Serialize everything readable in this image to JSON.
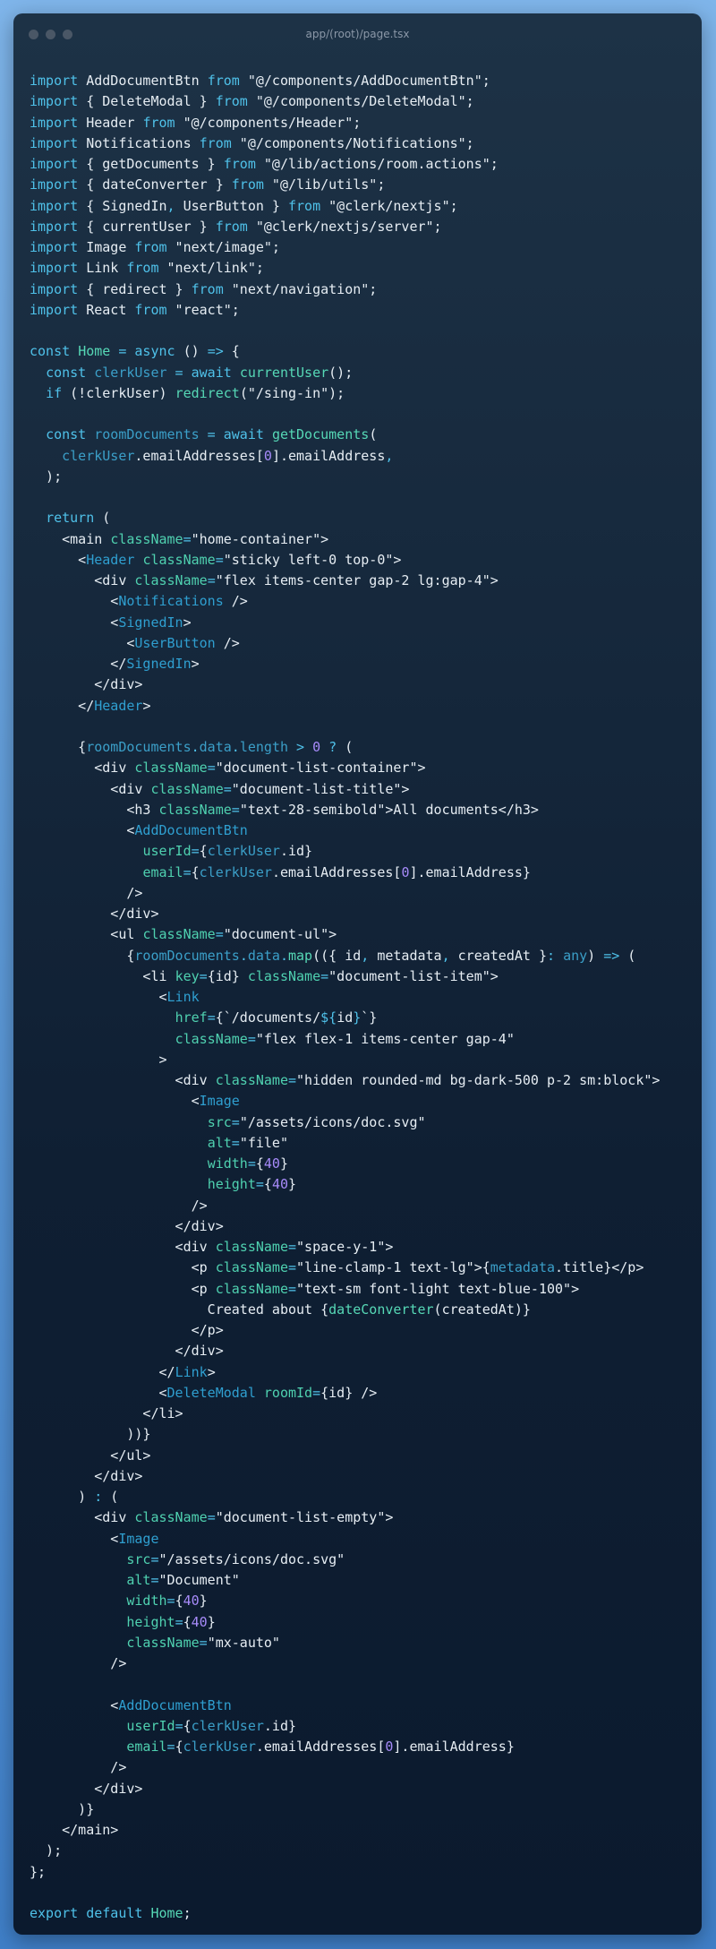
{
  "window": {
    "title": "app/(root)/page.tsx"
  },
  "colors": {
    "keyword": "#4fc1e9",
    "variable": "#3b9fc8",
    "function": "#56d8b6",
    "tag": "#2f9fd0",
    "attribute": "#4fd1b0",
    "number": "#a78bfa",
    "text": "#e6edf3"
  },
  "code_lines": [
    [
      [
        "kw",
        "import"
      ],
      [
        "p",
        " AddDocumentBtn "
      ],
      [
        "kw",
        "from"
      ],
      [
        "s",
        " \"@/components/AddDocumentBtn\";"
      ]
    ],
    [
      [
        "kw",
        "import"
      ],
      [
        "p",
        " { DeleteModal } "
      ],
      [
        "kw",
        "from"
      ],
      [
        "s",
        " \"@/components/DeleteModal\";"
      ]
    ],
    [
      [
        "kw",
        "import"
      ],
      [
        "p",
        " Header "
      ],
      [
        "kw",
        "from"
      ],
      [
        "s",
        " \"@/components/Header\";"
      ]
    ],
    [
      [
        "kw",
        "import"
      ],
      [
        "p",
        " Notifications "
      ],
      [
        "kw",
        "from"
      ],
      [
        "s",
        " \"@/components/Notifications\";"
      ]
    ],
    [
      [
        "kw",
        "import"
      ],
      [
        "p",
        " { getDocuments } "
      ],
      [
        "kw",
        "from"
      ],
      [
        "s",
        " \"@/lib/actions/room.actions\";"
      ]
    ],
    [
      [
        "kw",
        "import"
      ],
      [
        "p",
        " { dateConverter } "
      ],
      [
        "kw",
        "from"
      ],
      [
        "s",
        " \"@/lib/utils\";"
      ]
    ],
    [
      [
        "kw",
        "import"
      ],
      [
        "p",
        " { SignedIn"
      ],
      [
        "kw",
        ","
      ],
      [
        "p",
        " UserButton } "
      ],
      [
        "kw",
        "from"
      ],
      [
        "s",
        " \"@clerk/nextjs\";"
      ]
    ],
    [
      [
        "kw",
        "import"
      ],
      [
        "p",
        " { currentUser } "
      ],
      [
        "kw",
        "from"
      ],
      [
        "s",
        " \"@clerk/nextjs/server\";"
      ]
    ],
    [
      [
        "kw",
        "import"
      ],
      [
        "p",
        " Image "
      ],
      [
        "kw",
        "from"
      ],
      [
        "s",
        " \"next/image\";"
      ]
    ],
    [
      [
        "kw",
        "import"
      ],
      [
        "p",
        " Link "
      ],
      [
        "kw",
        "from"
      ],
      [
        "s",
        " \"next/link\";"
      ]
    ],
    [
      [
        "kw",
        "import"
      ],
      [
        "p",
        " { redirect } "
      ],
      [
        "kw",
        "from"
      ],
      [
        "s",
        " \"next/navigation\";"
      ]
    ],
    [
      [
        "kw",
        "import"
      ],
      [
        "p",
        " React "
      ],
      [
        "kw",
        "from"
      ],
      [
        "s",
        " \"react\";"
      ]
    ],
    [],
    [
      [
        "kw",
        "const"
      ],
      [
        "p",
        " "
      ],
      [
        "fn",
        "Home"
      ],
      [
        "kw",
        " = async"
      ],
      [
        "p",
        " () "
      ],
      [
        "kw",
        "=>"
      ],
      [
        "p",
        " {"
      ]
    ],
    [
      [
        "p",
        "  "
      ],
      [
        "kw",
        "const"
      ],
      [
        "p",
        " "
      ],
      [
        "var",
        "clerkUser"
      ],
      [
        "kw",
        " = await"
      ],
      [
        "p",
        " "
      ],
      [
        "fn",
        "currentUser"
      ],
      [
        "p",
        "();"
      ]
    ],
    [
      [
        "p",
        "  "
      ],
      [
        "kw",
        "if"
      ],
      [
        "p",
        " (!clerkUser) "
      ],
      [
        "fn",
        "redirect"
      ],
      [
        "p",
        "(\"/sing-in\");"
      ]
    ],
    [],
    [
      [
        "p",
        "  "
      ],
      [
        "kw",
        "const"
      ],
      [
        "p",
        " "
      ],
      [
        "var",
        "roomDocuments"
      ],
      [
        "kw",
        " = await"
      ],
      [
        "p",
        " "
      ],
      [
        "fn",
        "getDocuments"
      ],
      [
        "p",
        "("
      ]
    ],
    [
      [
        "p",
        "    "
      ],
      [
        "var",
        "clerkUser"
      ],
      [
        "p",
        ".emailAddresses["
      ],
      [
        "num",
        "0"
      ],
      [
        "p",
        "].emailAddress"
      ],
      [
        "kw",
        ","
      ]
    ],
    [
      [
        "p",
        "  );"
      ]
    ],
    [],
    [
      [
        "p",
        "  "
      ],
      [
        "kw",
        "return"
      ],
      [
        "p",
        " ("
      ]
    ],
    [
      [
        "p",
        "    <main "
      ],
      [
        "attr",
        "className"
      ],
      [
        "kw",
        "="
      ],
      [
        "s",
        "\"home-container\">"
      ]
    ],
    [
      [
        "p",
        "      <"
      ],
      [
        "tag",
        "Header"
      ],
      [
        "p",
        " "
      ],
      [
        "attr",
        "className"
      ],
      [
        "kw",
        "="
      ],
      [
        "s",
        "\"sticky left-0 top-0\">"
      ]
    ],
    [
      [
        "p",
        "        <div "
      ],
      [
        "attr",
        "className"
      ],
      [
        "kw",
        "="
      ],
      [
        "s",
        "\"flex items-center gap-2 lg:gap-4\">"
      ]
    ],
    [
      [
        "p",
        "          <"
      ],
      [
        "tag",
        "Notifications"
      ],
      [
        "p",
        " />"
      ]
    ],
    [
      [
        "p",
        "          <"
      ],
      [
        "tag",
        "SignedIn"
      ],
      [
        "p",
        ">"
      ]
    ],
    [
      [
        "p",
        "            <"
      ],
      [
        "tag",
        "UserButton"
      ],
      [
        "p",
        " />"
      ]
    ],
    [
      [
        "p",
        "          </"
      ],
      [
        "tag",
        "SignedIn"
      ],
      [
        "p",
        ">"
      ]
    ],
    [
      [
        "p",
        "        </div>"
      ]
    ],
    [
      [
        "p",
        "      </"
      ],
      [
        "tag",
        "Header"
      ],
      [
        "p",
        ">"
      ]
    ],
    [],
    [
      [
        "p",
        "      {"
      ],
      [
        "var",
        "roomDocuments"
      ],
      [
        "kw",
        "."
      ],
      [
        "var",
        "data"
      ],
      [
        "kw",
        "."
      ],
      [
        "var",
        "length"
      ],
      [
        "kw",
        " > "
      ],
      [
        "num",
        "0"
      ],
      [
        "kw",
        " ?"
      ],
      [
        "p",
        " ("
      ]
    ],
    [
      [
        "p",
        "        <div "
      ],
      [
        "attr",
        "className"
      ],
      [
        "kw",
        "="
      ],
      [
        "s",
        "\"document-list-container\">"
      ]
    ],
    [
      [
        "p",
        "          <div "
      ],
      [
        "attr",
        "className"
      ],
      [
        "kw",
        "="
      ],
      [
        "s",
        "\"document-list-title\">"
      ]
    ],
    [
      [
        "p",
        "            <h3 "
      ],
      [
        "attr",
        "className"
      ],
      [
        "kw",
        "="
      ],
      [
        "s",
        "\"text-28-semibold\">All documents</h3>"
      ]
    ],
    [
      [
        "p",
        "            <"
      ],
      [
        "tag",
        "AddDocumentBtn"
      ]
    ],
    [
      [
        "p",
        "              "
      ],
      [
        "attr",
        "userId"
      ],
      [
        "kw",
        "="
      ],
      [
        "p",
        "{"
      ],
      [
        "var",
        "clerkUser"
      ],
      [
        "p",
        ".id}"
      ]
    ],
    [
      [
        "p",
        "              "
      ],
      [
        "attr",
        "email"
      ],
      [
        "kw",
        "="
      ],
      [
        "p",
        "{"
      ],
      [
        "var",
        "clerkUser"
      ],
      [
        "p",
        ".emailAddresses["
      ],
      [
        "num",
        "0"
      ],
      [
        "p",
        "].emailAddress}"
      ]
    ],
    [
      [
        "p",
        "            />"
      ]
    ],
    [
      [
        "p",
        "          </div>"
      ]
    ],
    [
      [
        "p",
        "          <ul "
      ],
      [
        "attr",
        "className"
      ],
      [
        "kw",
        "="
      ],
      [
        "s",
        "\"document-ul\">"
      ]
    ],
    [
      [
        "p",
        "            {"
      ],
      [
        "var",
        "roomDocuments"
      ],
      [
        "kw",
        "."
      ],
      [
        "var",
        "data"
      ],
      [
        "kw",
        "."
      ],
      [
        "fn",
        "map"
      ],
      [
        "p",
        "(({ id"
      ],
      [
        "kw",
        ","
      ],
      [
        "p",
        " metadata"
      ],
      [
        "kw",
        ","
      ],
      [
        "p",
        " createdAt }"
      ],
      [
        "kw",
        ":"
      ],
      [
        "p",
        " "
      ],
      [
        "var",
        "any"
      ],
      [
        "p",
        ") "
      ],
      [
        "kw",
        "=>"
      ],
      [
        "p",
        " ("
      ]
    ],
    [
      [
        "p",
        "              <li "
      ],
      [
        "attr",
        "key"
      ],
      [
        "kw",
        "="
      ],
      [
        "p",
        "{id} "
      ],
      [
        "attr",
        "className"
      ],
      [
        "kw",
        "="
      ],
      [
        "s",
        "\"document-list-item\">"
      ]
    ],
    [
      [
        "p",
        "                <"
      ],
      [
        "tag",
        "Link"
      ]
    ],
    [
      [
        "p",
        "                  "
      ],
      [
        "attr",
        "href"
      ],
      [
        "kw",
        "="
      ],
      [
        "p",
        "{`/documents/"
      ],
      [
        "kw",
        "${"
      ],
      [
        "p",
        "id"
      ],
      [
        "kw",
        "}"
      ],
      [
        "p",
        "`}"
      ]
    ],
    [
      [
        "p",
        "                  "
      ],
      [
        "attr",
        "className"
      ],
      [
        "kw",
        "="
      ],
      [
        "s",
        "\"flex flex-1 items-center gap-4\""
      ]
    ],
    [
      [
        "p",
        "                >"
      ]
    ],
    [
      [
        "p",
        "                  <div "
      ],
      [
        "attr",
        "className"
      ],
      [
        "kw",
        "="
      ],
      [
        "s",
        "\"hidden rounded-md bg-dark-500 p-2 sm:block\">"
      ]
    ],
    [
      [
        "p",
        "                    <"
      ],
      [
        "tag",
        "Image"
      ]
    ],
    [
      [
        "p",
        "                      "
      ],
      [
        "attr",
        "src"
      ],
      [
        "kw",
        "="
      ],
      [
        "s",
        "\"/assets/icons/doc.svg\""
      ]
    ],
    [
      [
        "p",
        "                      "
      ],
      [
        "attr",
        "alt"
      ],
      [
        "kw",
        "="
      ],
      [
        "s",
        "\"file\""
      ]
    ],
    [
      [
        "p",
        "                      "
      ],
      [
        "attr",
        "width"
      ],
      [
        "kw",
        "="
      ],
      [
        "p",
        "{"
      ],
      [
        "num",
        "40"
      ],
      [
        "p",
        "}"
      ]
    ],
    [
      [
        "p",
        "                      "
      ],
      [
        "attr",
        "height"
      ],
      [
        "kw",
        "="
      ],
      [
        "p",
        "{"
      ],
      [
        "num",
        "40"
      ],
      [
        "p",
        "}"
      ]
    ],
    [
      [
        "p",
        "                    />"
      ]
    ],
    [
      [
        "p",
        "                  </div>"
      ]
    ],
    [
      [
        "p",
        "                  <div "
      ],
      [
        "attr",
        "className"
      ],
      [
        "kw",
        "="
      ],
      [
        "s",
        "\"space-y-1\">"
      ]
    ],
    [
      [
        "p",
        "                    <p "
      ],
      [
        "attr",
        "className"
      ],
      [
        "kw",
        "="
      ],
      [
        "s",
        "\"line-clamp-1 text-lg\">{"
      ],
      [
        "var",
        "metadata"
      ],
      [
        "p",
        ".title}</p>"
      ]
    ],
    [
      [
        "p",
        "                    <p "
      ],
      [
        "attr",
        "className"
      ],
      [
        "kw",
        "="
      ],
      [
        "s",
        "\"text-sm font-light text-blue-100\">"
      ]
    ],
    [
      [
        "p",
        "                      Created about {"
      ],
      [
        "fn",
        "dateConverter"
      ],
      [
        "p",
        "(createdAt)}"
      ]
    ],
    [
      [
        "p",
        "                    </p>"
      ]
    ],
    [
      [
        "p",
        "                  </div>"
      ]
    ],
    [
      [
        "p",
        "                </"
      ],
      [
        "tag",
        "Link"
      ],
      [
        "p",
        ">"
      ]
    ],
    [
      [
        "p",
        "                <"
      ],
      [
        "tag",
        "DeleteModal"
      ],
      [
        "p",
        " "
      ],
      [
        "attr",
        "roomId"
      ],
      [
        "kw",
        "="
      ],
      [
        "p",
        "{id} />"
      ]
    ],
    [
      [
        "p",
        "              </li>"
      ]
    ],
    [
      [
        "p",
        "            ))}"
      ]
    ],
    [
      [
        "p",
        "          </ul>"
      ]
    ],
    [
      [
        "p",
        "        </div>"
      ]
    ],
    [
      [
        "p",
        "      ) "
      ],
      [
        "kw",
        ":"
      ],
      [
        "p",
        " ("
      ]
    ],
    [
      [
        "p",
        "        <div "
      ],
      [
        "attr",
        "className"
      ],
      [
        "kw",
        "="
      ],
      [
        "s",
        "\"document-list-empty\">"
      ]
    ],
    [
      [
        "p",
        "          <"
      ],
      [
        "tag",
        "Image"
      ]
    ],
    [
      [
        "p",
        "            "
      ],
      [
        "attr",
        "src"
      ],
      [
        "kw",
        "="
      ],
      [
        "s",
        "\"/assets/icons/doc.svg\""
      ]
    ],
    [
      [
        "p",
        "            "
      ],
      [
        "attr",
        "alt"
      ],
      [
        "kw",
        "="
      ],
      [
        "s",
        "\"Document\""
      ]
    ],
    [
      [
        "p",
        "            "
      ],
      [
        "attr",
        "width"
      ],
      [
        "kw",
        "="
      ],
      [
        "p",
        "{"
      ],
      [
        "num",
        "40"
      ],
      [
        "p",
        "}"
      ]
    ],
    [
      [
        "p",
        "            "
      ],
      [
        "attr",
        "height"
      ],
      [
        "kw",
        "="
      ],
      [
        "p",
        "{"
      ],
      [
        "num",
        "40"
      ],
      [
        "p",
        "}"
      ]
    ],
    [
      [
        "p",
        "            "
      ],
      [
        "attr",
        "className"
      ],
      [
        "kw",
        "="
      ],
      [
        "s",
        "\"mx-auto\""
      ]
    ],
    [
      [
        "p",
        "          />"
      ]
    ],
    [],
    [
      [
        "p",
        "          <"
      ],
      [
        "tag",
        "AddDocumentBtn"
      ]
    ],
    [
      [
        "p",
        "            "
      ],
      [
        "attr",
        "userId"
      ],
      [
        "kw",
        "="
      ],
      [
        "p",
        "{"
      ],
      [
        "var",
        "clerkUser"
      ],
      [
        "p",
        ".id}"
      ]
    ],
    [
      [
        "p",
        "            "
      ],
      [
        "attr",
        "email"
      ],
      [
        "kw",
        "="
      ],
      [
        "p",
        "{"
      ],
      [
        "var",
        "clerkUser"
      ],
      [
        "p",
        ".emailAddresses["
      ],
      [
        "num",
        "0"
      ],
      [
        "p",
        "].emailAddress}"
      ]
    ],
    [
      [
        "p",
        "          />"
      ]
    ],
    [
      [
        "p",
        "        </div>"
      ]
    ],
    [
      [
        "p",
        "      )}"
      ]
    ],
    [
      [
        "p",
        "    </main>"
      ]
    ],
    [
      [
        "p",
        "  );"
      ]
    ],
    [
      [
        "p",
        "};"
      ]
    ],
    [],
    [
      [
        "kw",
        "export default"
      ],
      [
        "p",
        " "
      ],
      [
        "fn",
        "Home"
      ],
      [
        "p",
        ";"
      ]
    ]
  ]
}
